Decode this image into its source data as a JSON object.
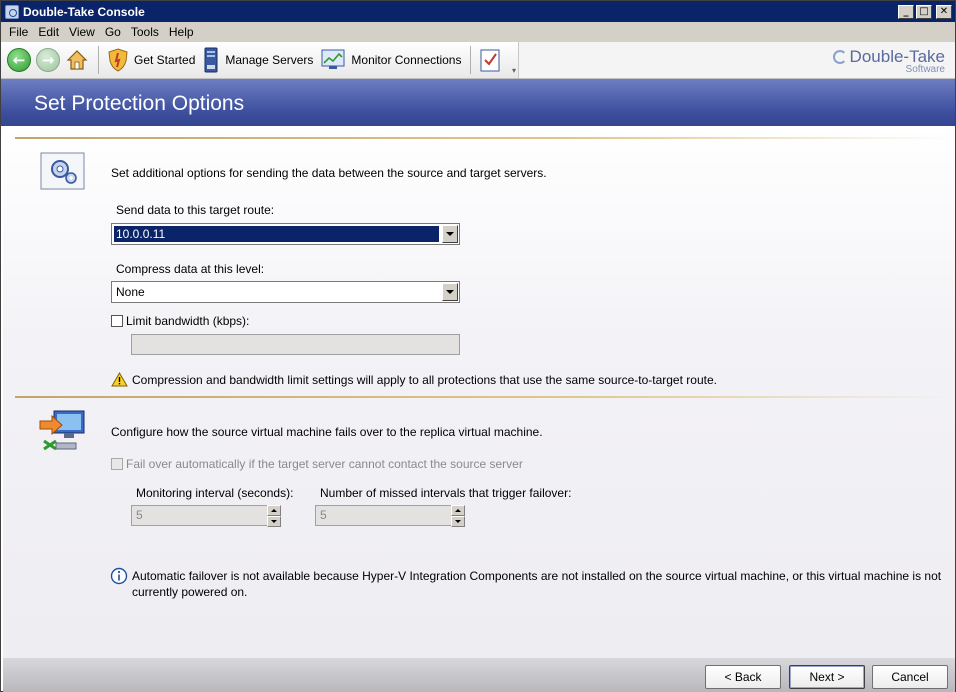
{
  "window": {
    "title": "Double-Take Console"
  },
  "menu": [
    "File",
    "Edit",
    "View",
    "Go",
    "Tools",
    "Help"
  ],
  "toolbar": {
    "get_started": "Get Started",
    "manage_servers": "Manage Servers",
    "monitor_connections": "Monitor Connections",
    "brand_name": "Double-Take",
    "brand_sub": "Software"
  },
  "page": {
    "title": "Set Protection Options"
  },
  "data_section": {
    "description": "Set additional options for sending the data between the source and target servers.",
    "route_label": "Send data to this target route:",
    "route_value": "10.0.0.11",
    "compress_label": "Compress data at this level:",
    "compress_value": "None",
    "limit_bandwidth_label": "Limit bandwidth (kbps):",
    "limit_bandwidth_checked": false,
    "warning": "Compression and bandwidth limit settings will apply to all protections that use the same source-to-target route."
  },
  "failover_section": {
    "description": "Configure how the source virtual machine fails over to the replica virtual machine.",
    "auto_failover_label": "Fail over automatically if the target server cannot contact the source server",
    "auto_failover_checked": false,
    "monitoring_label": "Monitoring interval (seconds):",
    "monitoring_value": "5",
    "missed_label": "Number of missed intervals that trigger failover:",
    "missed_value": "5",
    "info_line1": "Automatic failover is not available because Hyper-V Integration Components are not installed on the source virtual machine, or this virtual machine is not",
    "info_line2": "currently powered on."
  },
  "footer": {
    "back": "< Back",
    "next": "Next >",
    "cancel": "Cancel"
  },
  "colors": {
    "titlebar": "#0a246a",
    "header_band": "#3d4f9e",
    "rule": "#c4a46a",
    "selection": "#0a246a"
  }
}
